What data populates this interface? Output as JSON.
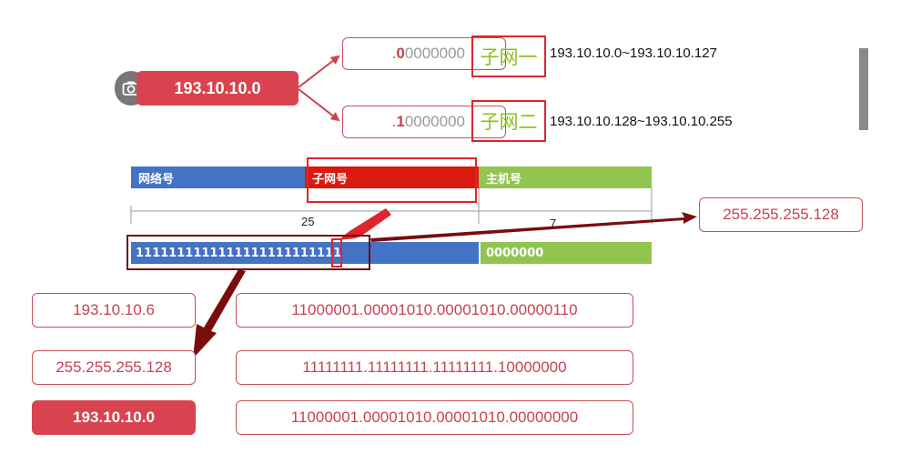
{
  "network_address": "193.10.10.0",
  "subnets": [
    {
      "binary_prefix": ".",
      "binary_highlight": "0",
      "binary_rest": "0000000",
      "label": "子网一",
      "range": "193.10.10.0~193.10.10.127"
    },
    {
      "binary_prefix": ".",
      "binary_highlight": "1",
      "binary_rest": "0000000",
      "label": "子网二",
      "range": "193.10.10.128~193.10.10.255"
    }
  ],
  "address_bar": {
    "network_label": "网络号",
    "subnet_label": "子网号",
    "host_label": "主机号"
  },
  "bit_counts": {
    "network_subnet_bits": "25",
    "host_bits": "7"
  },
  "mask_bits": {
    "ones": "1111111111111111111111111",
    "zeros": "0000000"
  },
  "mask_result": "255.255.255.128",
  "calculation": {
    "rows": [
      {
        "decimal": "193.10.10.6",
        "binary": "11000001.00001010.00001010.00000110",
        "highlight": false
      },
      {
        "decimal": "255.255.255.128",
        "binary": "11111111.11111111.11111111.10000000",
        "highlight": false
      },
      {
        "decimal": "193.10.10.0",
        "binary": "11000001.00001010.00001010.00000000",
        "highlight": true
      }
    ]
  },
  "colors": {
    "accent_red": "#d9434f",
    "network_blue": "#4472c4",
    "subnet_red": "#d91a0e",
    "host_green": "#92c450",
    "arrow_dark_red": "#7a0c0c",
    "connector_red": "#c8424f"
  }
}
